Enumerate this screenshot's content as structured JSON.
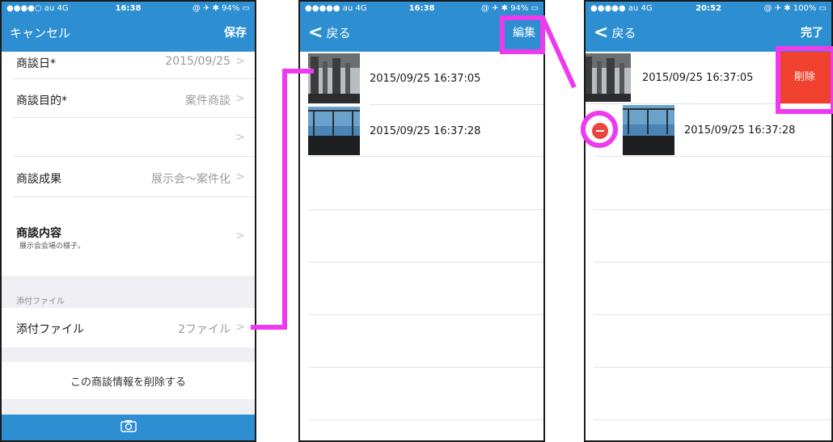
{
  "colors": {
    "accent": "#2d8fd1",
    "delete": "#f0412f",
    "annotation": "#ee3aee"
  },
  "screen1": {
    "status": {
      "carrier": "●●●●○ au  4G",
      "time": "16:38",
      "right": "@ ✈ ✱ 94% ▭"
    },
    "nav": {
      "cancel": "キャンセル",
      "save": "保存"
    },
    "rows": [
      {
        "label": "商談日*",
        "value": "2015/09/25"
      },
      {
        "label": "商談目的*",
        "value": "案件商談"
      },
      {
        "label": "",
        "value": ""
      },
      {
        "label": "商談成果",
        "value": "展示会〜案件化"
      }
    ],
    "content_row": {
      "label": "商談内容",
      "sub": "展示会会場の様子。"
    },
    "attach_section_header": "添付ファイル",
    "attach_row": {
      "label": "添付ファイル",
      "value": "2ファイル"
    },
    "delete_link": "この商談情報を削除する",
    "camera_icon": "camera-icon"
  },
  "screen2": {
    "status": {
      "carrier": "●●●●● au  4G",
      "time": "16:38",
      "right": "@ ✈ ✱ 94% ▭"
    },
    "nav": {
      "back": "戻る",
      "edit": "編集"
    },
    "photos": [
      {
        "timestamp": "2015/09/25 16:37:05"
      },
      {
        "timestamp": "2015/09/25 16:37:28"
      }
    ]
  },
  "screen3": {
    "status": {
      "carrier": "●●●●● au  4G",
      "time": "20:52",
      "right": "@ ✈ ✱ 100% ▭"
    },
    "nav": {
      "back": "戻る",
      "done": "完了"
    },
    "photos": [
      {
        "timestamp": "2015/09/25 16:37:05"
      },
      {
        "timestamp": "2015/09/25 16:37:28"
      }
    ],
    "delete_button": "削除"
  }
}
